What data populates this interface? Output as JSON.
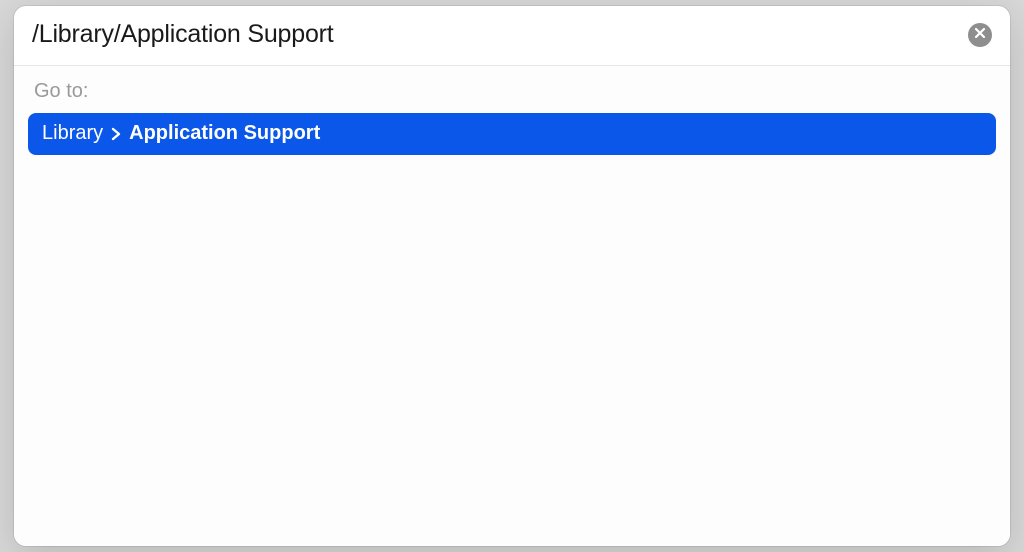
{
  "input": {
    "path": "/Library/Application Support"
  },
  "labels": {
    "go_to": "Go to:"
  },
  "suggestion": {
    "crumbs": [
      "Library",
      "Application Support"
    ]
  },
  "icons": {
    "close": "close-icon",
    "chevron": "chevron-right-icon"
  },
  "colors": {
    "selection": "#0b57e9"
  }
}
